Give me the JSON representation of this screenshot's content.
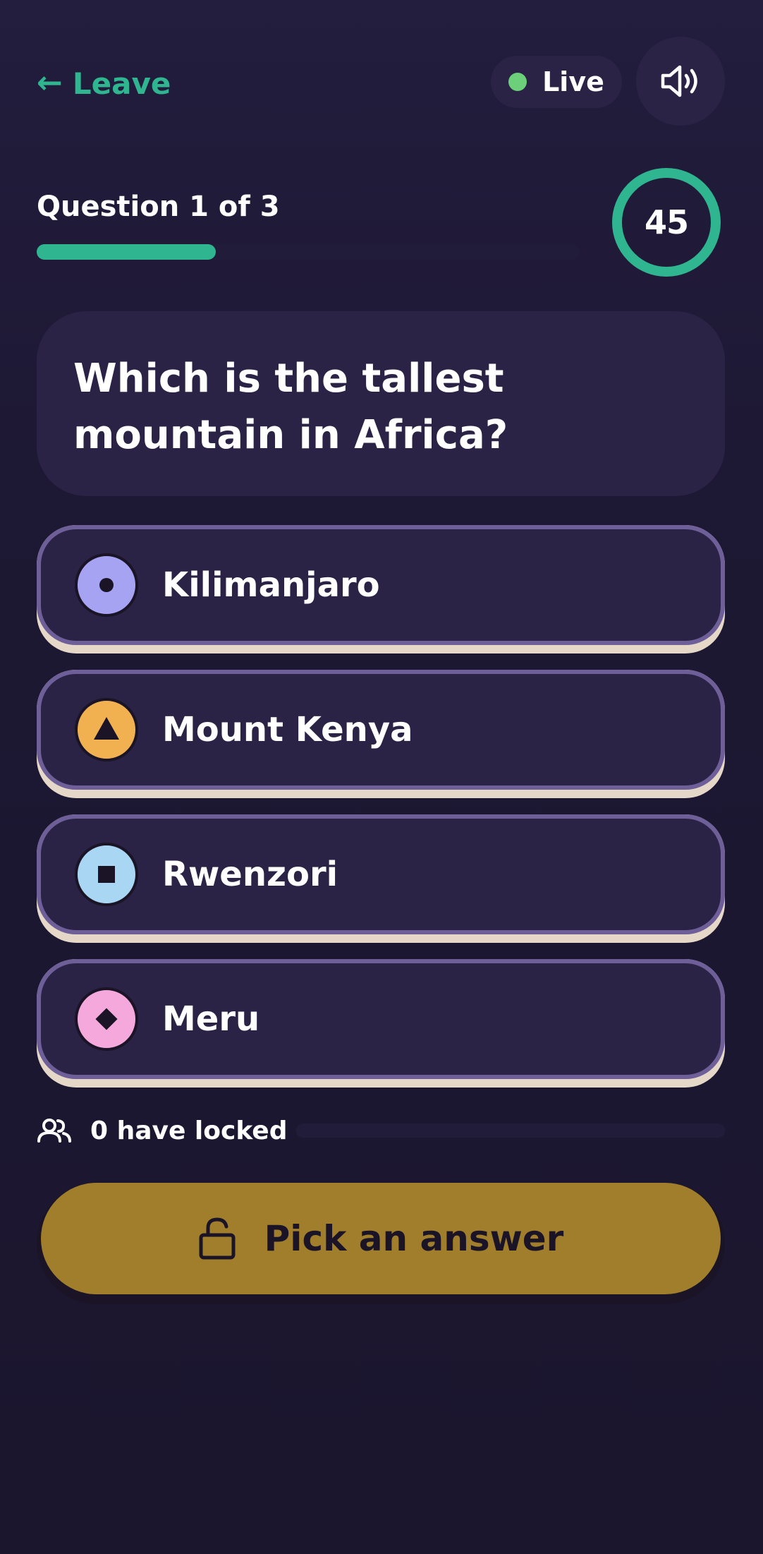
{
  "header": {
    "leave_arrow": "←",
    "leave_label": "Leave",
    "live_label": "Live",
    "live_color": "#6cd07b",
    "sound_icon": "speaker-icon"
  },
  "progress": {
    "question_label": "Question 1 of 3",
    "current": 1,
    "total": 3,
    "fraction": 0.33,
    "timer_value": "45",
    "accent": "#2fb58f"
  },
  "question": {
    "text": "Which is the tallest mountain in Africa?"
  },
  "options": [
    {
      "label": "Kilimanjaro",
      "shape": "circle",
      "color": "#a6a3f2"
    },
    {
      "label": "Mount Kenya",
      "shape": "triangle",
      "color": "#f2b150"
    },
    {
      "label": "Rwenzori",
      "shape": "square",
      "color": "#a8d6f3"
    },
    {
      "label": "Meru",
      "shape": "diamond",
      "color": "#f5a8dc"
    }
  ],
  "status": {
    "locked_text": "0 have locked",
    "locked_icon": "users-icon"
  },
  "action": {
    "pick_label": "Pick an answer",
    "pick_icon": "unlock-icon",
    "color": "#a17e2b"
  }
}
